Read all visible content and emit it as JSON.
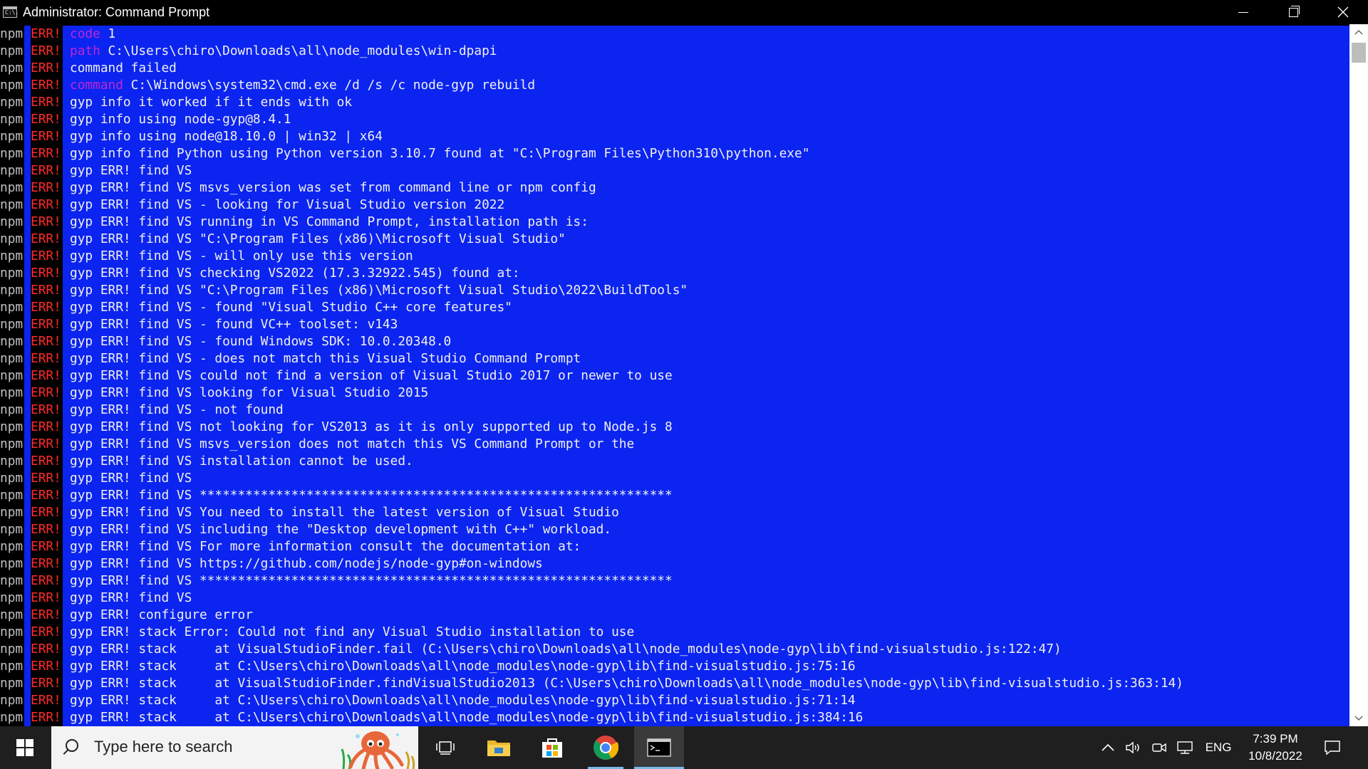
{
  "window": {
    "title": "Administrator: Command Prompt",
    "icon_text": "C:\\."
  },
  "console": {
    "prefix_npm": "npm",
    "prefix_err": "ERR!",
    "lines": [
      {
        "label": "code",
        "text": " 1"
      },
      {
        "label": "path",
        "text": " C:\\Users\\chiro\\Downloads\\all\\node_modules\\win-dpapi"
      },
      {
        "label": "",
        "text": "command failed"
      },
      {
        "label": "command",
        "text": " C:\\Windows\\system32\\cmd.exe /d /s /c node-gyp rebuild"
      },
      {
        "label": "",
        "text": "gyp info it worked if it ends with ok"
      },
      {
        "label": "",
        "text": "gyp info using node-gyp@8.4.1"
      },
      {
        "label": "",
        "text": "gyp info using node@18.10.0 | win32 | x64"
      },
      {
        "label": "",
        "text": "gyp info find Python using Python version 3.10.7 found at \"C:\\Program Files\\Python310\\python.exe\""
      },
      {
        "label": "",
        "text": "gyp ERR! find VS"
      },
      {
        "label": "",
        "text": "gyp ERR! find VS msvs_version was set from command line or npm config"
      },
      {
        "label": "",
        "text": "gyp ERR! find VS - looking for Visual Studio version 2022"
      },
      {
        "label": "",
        "text": "gyp ERR! find VS running in VS Command Prompt, installation path is:"
      },
      {
        "label": "",
        "text": "gyp ERR! find VS \"C:\\Program Files (x86)\\Microsoft Visual Studio\""
      },
      {
        "label": "",
        "text": "gyp ERR! find VS - will only use this version"
      },
      {
        "label": "",
        "text": "gyp ERR! find VS checking VS2022 (17.3.32922.545) found at:"
      },
      {
        "label": "",
        "text": "gyp ERR! find VS \"C:\\Program Files (x86)\\Microsoft Visual Studio\\2022\\BuildTools\""
      },
      {
        "label": "",
        "text": "gyp ERR! find VS - found \"Visual Studio C++ core features\""
      },
      {
        "label": "",
        "text": "gyp ERR! find VS - found VC++ toolset: v143"
      },
      {
        "label": "",
        "text": "gyp ERR! find VS - found Windows SDK: 10.0.20348.0"
      },
      {
        "label": "",
        "text": "gyp ERR! find VS - does not match this Visual Studio Command Prompt"
      },
      {
        "label": "",
        "text": "gyp ERR! find VS could not find a version of Visual Studio 2017 or newer to use"
      },
      {
        "label": "",
        "text": "gyp ERR! find VS looking for Visual Studio 2015"
      },
      {
        "label": "",
        "text": "gyp ERR! find VS - not found"
      },
      {
        "label": "",
        "text": "gyp ERR! find VS not looking for VS2013 as it is only supported up to Node.js 8"
      },
      {
        "label": "",
        "text": "gyp ERR! find VS msvs_version does not match this VS Command Prompt or the"
      },
      {
        "label": "",
        "text": "gyp ERR! find VS installation cannot be used."
      },
      {
        "label": "",
        "text": "gyp ERR! find VS"
      },
      {
        "label": "",
        "text": "gyp ERR! find VS **************************************************************"
      },
      {
        "label": "",
        "text": "gyp ERR! find VS You need to install the latest version of Visual Studio"
      },
      {
        "label": "",
        "text": "gyp ERR! find VS including the \"Desktop development with C++\" workload."
      },
      {
        "label": "",
        "text": "gyp ERR! find VS For more information consult the documentation at:"
      },
      {
        "label": "",
        "text": "gyp ERR! find VS https://github.com/nodejs/node-gyp#on-windows"
      },
      {
        "label": "",
        "text": "gyp ERR! find VS **************************************************************"
      },
      {
        "label": "",
        "text": "gyp ERR! find VS"
      },
      {
        "label": "",
        "text": "gyp ERR! configure error"
      },
      {
        "label": "",
        "text": "gyp ERR! stack Error: Could not find any Visual Studio installation to use"
      },
      {
        "label": "",
        "text": "gyp ERR! stack     at VisualStudioFinder.fail (C:\\Users\\chiro\\Downloads\\all\\node_modules\\node-gyp\\lib\\find-visualstudio.js:122:47)"
      },
      {
        "label": "",
        "text": "gyp ERR! stack     at C:\\Users\\chiro\\Downloads\\all\\node_modules\\node-gyp\\lib\\find-visualstudio.js:75:16"
      },
      {
        "label": "",
        "text": "gyp ERR! stack     at VisualStudioFinder.findVisualStudio2013 (C:\\Users\\chiro\\Downloads\\all\\node_modules\\node-gyp\\lib\\find-visualstudio.js:363:14)"
      },
      {
        "label": "",
        "text": "gyp ERR! stack     at C:\\Users\\chiro\\Downloads\\all\\node_modules\\node-gyp\\lib\\find-visualstudio.js:71:14"
      },
      {
        "label": "",
        "text": "gyp ERR! stack     at C:\\Users\\chiro\\Downloads\\all\\node_modules\\node-gyp\\lib\\find-visualstudio.js:384:16"
      }
    ]
  },
  "taskbar": {
    "search_placeholder": "Type here to search",
    "language": "ENG",
    "time": "7:39 PM",
    "date": "10/8/2022",
    "icons": [
      "windows-start-icon",
      "search-icon",
      "task-view-icon",
      "file-explorer-icon",
      "microsoft-store-icon",
      "chrome-icon",
      "command-prompt-icon",
      "chevron-up-icon",
      "volume-icon",
      "meet-now-icon",
      "network-icon",
      "notification-icon"
    ]
  },
  "colors": {
    "selection": "#0b24f0",
    "err": "#ff2a2a",
    "label": "#c026d3",
    "taskbar": "#1f1f1f"
  }
}
